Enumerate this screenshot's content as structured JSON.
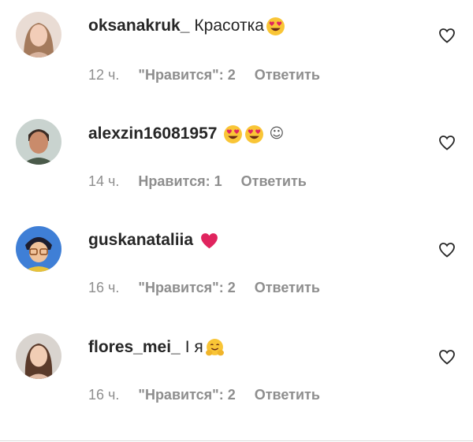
{
  "comments": [
    {
      "username": "oksanakruk_",
      "text": "Красотка",
      "emojis": [
        "heart-eyes-emoji"
      ],
      "time": "12 ч.",
      "likes": "\"Нравится\": 2",
      "reply": "Ответить"
    },
    {
      "username": "alexzin16081957",
      "text": "",
      "emojis": [
        "heart-eyes-emoji",
        "heart-eyes-emoji"
      ],
      "extra_glyph": "☺",
      "time": "14 ч.",
      "likes": "Нравится: 1",
      "reply": "Ответить"
    },
    {
      "username": "guskanataliia",
      "text": "",
      "emojis": [
        "red-heart-emoji"
      ],
      "time": "16 ч.",
      "likes": "\"Нравится\": 2",
      "reply": "Ответить"
    },
    {
      "username": "flores_mei_",
      "text": "І я",
      "emojis": [
        "hugging-face-emoji"
      ],
      "time": "16 ч.",
      "likes": "\"Нравится\": 2",
      "reply": "Ответить"
    }
  ],
  "icons": {
    "like": "heart-outline-icon"
  },
  "colors": {
    "text": "#262626",
    "meta": "#8e8e8e",
    "emoji_face": "#f9c536",
    "heart_red": "#e0245e"
  }
}
